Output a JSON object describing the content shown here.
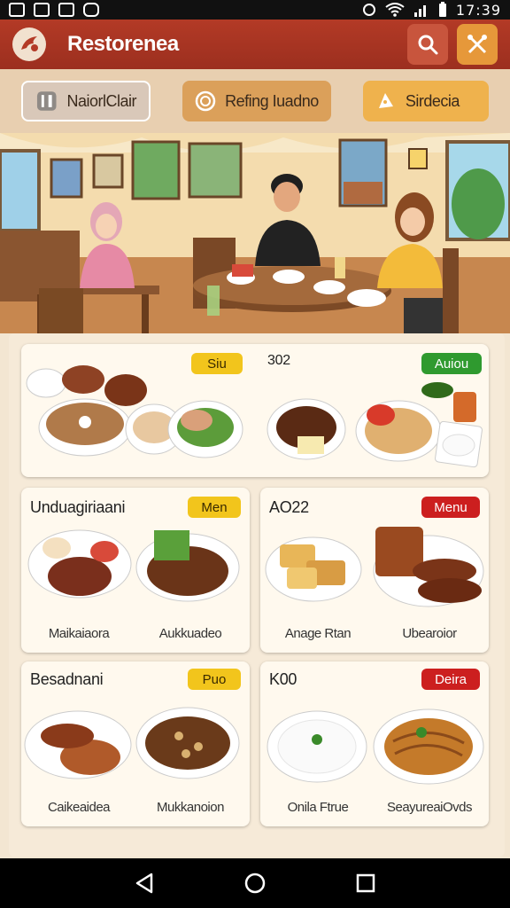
{
  "status": {
    "time": "17:39"
  },
  "appbar": {
    "title": "Restorenea"
  },
  "chips": [
    {
      "label": "NaiorlClair"
    },
    {
      "label": "Refing Iuadno"
    },
    {
      "label": "Sirdecia"
    }
  ],
  "featured": {
    "badge1": "Siu",
    "number": "302",
    "badge2": "Auiou"
  },
  "cards": [
    {
      "title": "Unduagiriaani",
      "badge": "Men",
      "dishes": [
        "Maikaiaora",
        "Aukkuadeo"
      ]
    },
    {
      "title": "AO22",
      "badge": "Menu",
      "dishes": [
        "Anage Rtan",
        "Ubearoior"
      ]
    },
    {
      "title": "Besadnani",
      "badge": "Puo",
      "dishes": [
        "Caikeaidea",
        "Mukkanoion"
      ]
    },
    {
      "title": "K00",
      "badge": "Deira",
      "dishes": [
        "Onila Ftrue",
        "SeayureaiOvds"
      ]
    }
  ],
  "colors": {
    "appbar": "#a8331f",
    "accent": "#e6983a",
    "badge_yellow": "#f2c51c",
    "badge_green": "#2f9a2f",
    "badge_red": "#cc1f1f"
  },
  "icons": [
    "wifi-icon",
    "signal-icon",
    "battery-icon",
    "search-icon",
    "tools-icon",
    "back-icon",
    "home-icon",
    "recents-icon"
  ]
}
